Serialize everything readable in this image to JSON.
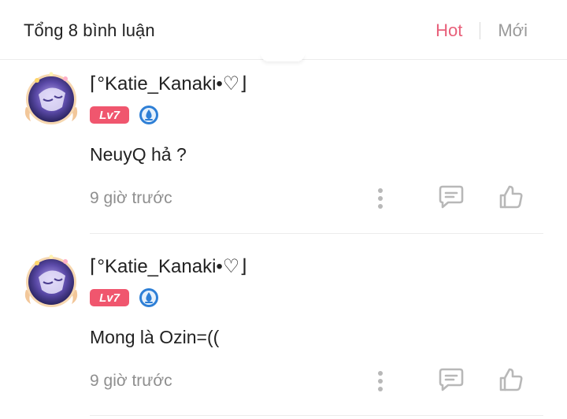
{
  "header": {
    "title": "Tổng 8 bình luận",
    "sort_hot": "Hot",
    "sort_new": "Mới"
  },
  "colors": {
    "accent": "#e8607a",
    "level_badge": "#f0566e",
    "rank_badge": "#2e7fd6",
    "muted_text": "#8f8f8f",
    "icon_gray": "#b8b8b8"
  },
  "comments": [
    {
      "username": "⌈°Katie_Kanaki•♡⌋",
      "level": "Lv7",
      "text": "NeuyQ hả ?",
      "time": "9 giờ trước",
      "icons": [
        "avatar",
        "rank-drop-icon",
        "more-vertical-icon",
        "reply-comment-icon",
        "like-thumb-icon"
      ]
    },
    {
      "username": "⌈°Katie_Kanaki•♡⌋",
      "level": "Lv7",
      "text": "Mong là Ozin=((",
      "time": "9 giờ trước",
      "icons": [
        "avatar",
        "rank-drop-icon",
        "more-vertical-icon",
        "reply-comment-icon",
        "like-thumb-icon"
      ]
    }
  ]
}
